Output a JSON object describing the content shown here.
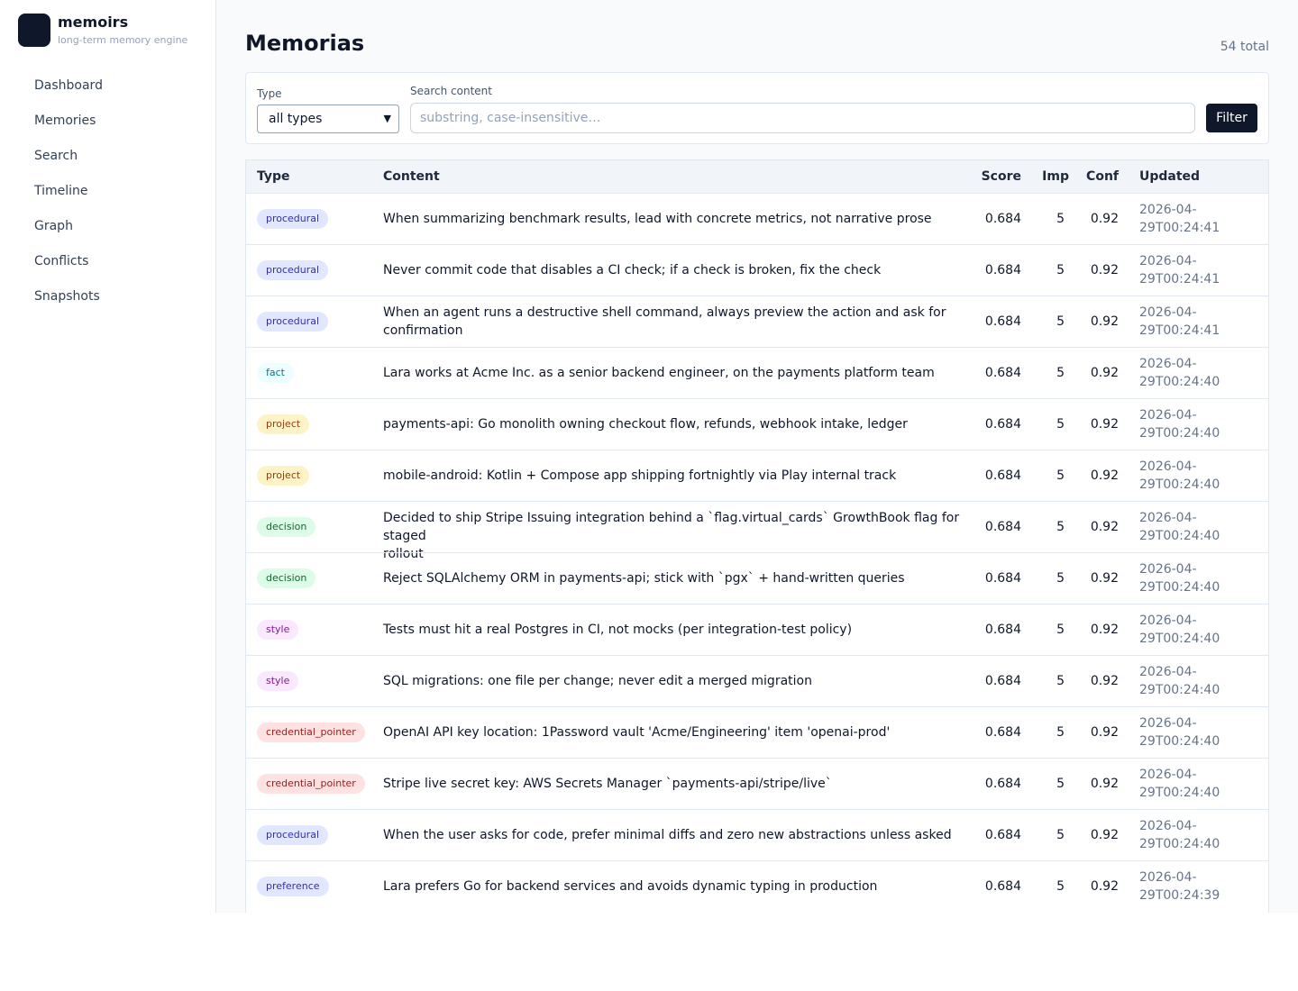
{
  "app": {
    "name": "memoirs",
    "tagline": "long-term memory engine"
  },
  "nav": [
    {
      "label": "Dashboard"
    },
    {
      "label": "Memories"
    },
    {
      "label": "Search"
    },
    {
      "label": "Timeline"
    },
    {
      "label": "Graph"
    },
    {
      "label": "Conflicts"
    },
    {
      "label": "Snapshots"
    }
  ],
  "page": {
    "title": "Memorias",
    "total": "54 total"
  },
  "filters": {
    "type_label": "Type",
    "type_value": "all types",
    "search_label": "Search content",
    "search_placeholder": "substring, case-insensitive…",
    "button_label": "Filter"
  },
  "table": {
    "headers": {
      "type": "Type",
      "content": "Content",
      "score": "Score",
      "imp": "Imp",
      "conf": "Conf",
      "updated": "Updated"
    },
    "rows": [
      {
        "type": "procedural",
        "content": "When summarizing benchmark results, lead with concrete metrics, not narrative prose",
        "score": "0.684",
        "imp": "5",
        "conf": "0.92",
        "updated_date": "2026-04-",
        "updated_time": "29T00:24:41"
      },
      {
        "type": "procedural",
        "content": "Never commit code that disables a CI check; if a check is broken, fix the check",
        "score": "0.684",
        "imp": "5",
        "conf": "0.92",
        "updated_date": "2026-04-",
        "updated_time": "29T00:24:41"
      },
      {
        "type": "procedural",
        "content_line1": "When an agent runs a destructive shell command, always preview the action and ask for",
        "content_line2": "confirmation",
        "score": "0.684",
        "imp": "5",
        "conf": "0.92",
        "updated_date": "2026-04-",
        "updated_time": "29T00:24:41"
      },
      {
        "type": "fact",
        "content": "Lara works at Acme Inc. as a senior backend engineer, on the payments platform team",
        "score": "0.684",
        "imp": "5",
        "conf": "0.92",
        "updated_date": "2026-04-",
        "updated_time": "29T00:24:40"
      },
      {
        "type": "project",
        "content": "payments-api: Go monolith owning checkout flow, refunds, webhook intake, ledger",
        "score": "0.684",
        "imp": "5",
        "conf": "0.92",
        "updated_date": "2026-04-",
        "updated_time": "29T00:24:40"
      },
      {
        "type": "project",
        "content": "mobile-android: Kotlin + Compose app shipping fortnightly via Play internal track",
        "score": "0.684",
        "imp": "5",
        "conf": "0.92",
        "updated_date": "2026-04-",
        "updated_time": "29T00:24:40"
      },
      {
        "type": "decision",
        "content_line1": "Decided to ship Stripe Issuing integration behind a `flag.virtual_cards` GrowthBook flag for staged",
        "content_line2": "rollout",
        "score": "0.684",
        "imp": "5",
        "conf": "0.92",
        "updated_date": "2026-04-",
        "updated_time": "29T00:24:40"
      },
      {
        "type": "decision",
        "content": "Reject SQLAlchemy ORM in payments-api; stick with `pgx` + hand-written queries",
        "score": "0.684",
        "imp": "5",
        "conf": "0.92",
        "updated_date": "2026-04-",
        "updated_time": "29T00:24:40"
      },
      {
        "type": "style",
        "content": "Tests must hit a real Postgres in CI, not mocks (per integration-test policy)",
        "score": "0.684",
        "imp": "5",
        "conf": "0.92",
        "updated_date": "2026-04-",
        "updated_time": "29T00:24:40"
      },
      {
        "type": "style",
        "content": "SQL migrations: one file per change; never edit a merged migration",
        "score": "0.684",
        "imp": "5",
        "conf": "0.92",
        "updated_date": "2026-04-",
        "updated_time": "29T00:24:40"
      },
      {
        "type": "credential_pointer",
        "content": "OpenAI API key location: 1Password vault 'Acme/Engineering' item 'openai-prod'",
        "score": "0.684",
        "imp": "5",
        "conf": "0.92",
        "updated_date": "2026-04-",
        "updated_time": "29T00:24:40"
      },
      {
        "type": "credential_pointer",
        "content": "Stripe live secret key: AWS Secrets Manager `payments-api/stripe/live`",
        "score": "0.684",
        "imp": "5",
        "conf": "0.92",
        "updated_date": "2026-04-",
        "updated_time": "29T00:24:40"
      },
      {
        "type": "procedural",
        "content": "When the user asks for code, prefer minimal diffs and zero new abstractions unless asked",
        "score": "0.684",
        "imp": "5",
        "conf": "0.92",
        "updated_date": "2026-04-",
        "updated_time": "29T00:24:40"
      },
      {
        "type": "preference",
        "content": "Lara prefers Go for backend services and avoids dynamic typing in production",
        "score": "0.684",
        "imp": "5",
        "conf": "0.92",
        "updated_date": "2026-04-",
        "updated_time": "29T00:24:39"
      }
    ]
  },
  "badge_colors": {
    "procedural": {
      "bg": "#e0e7ff",
      "fg": "#3730a3"
    },
    "fact": {
      "bg": "#ecfeff",
      "fg": "#0e7490"
    },
    "project": {
      "bg": "#fef3c7",
      "fg": "#92400e"
    },
    "decision": {
      "bg": "#dcfce7",
      "fg": "#166534"
    },
    "style": {
      "bg": "#fae8ff",
      "fg": "#86198f"
    },
    "credential_pointer": {
      "bg": "#fee2e2",
      "fg": "#991b1b"
    },
    "preference": {
      "bg": "#e0e7ff",
      "fg": "#3730a3"
    }
  }
}
